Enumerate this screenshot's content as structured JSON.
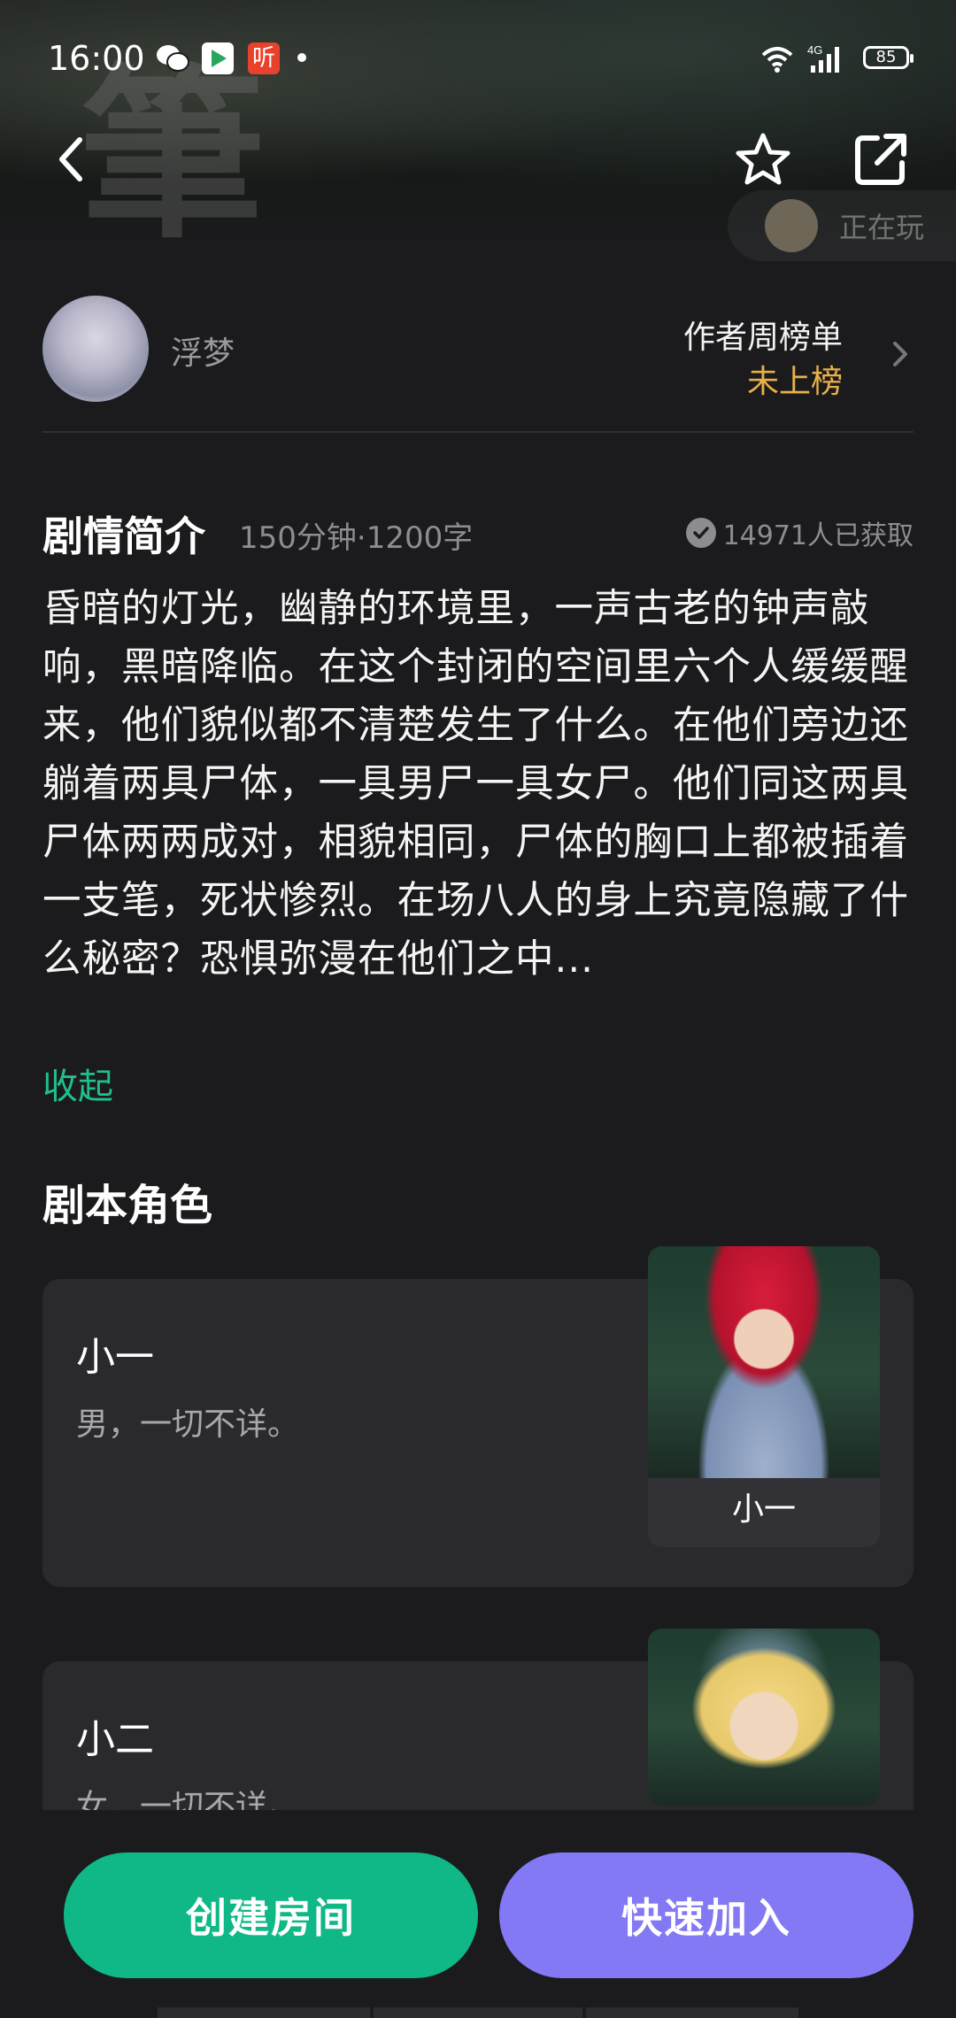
{
  "status_bar": {
    "time": "16:00",
    "battery": "85",
    "notification_icons": [
      "wechat-icon",
      "video-app-icon",
      "listen-app-icon",
      "dot-icon"
    ],
    "system_icons": [
      "wifi-icon",
      "signal-4g-icon",
      "battery-icon"
    ],
    "signal_label": "4G"
  },
  "header": {
    "back_icon": "chevron-left-icon",
    "favorite_icon": "star-icon",
    "share_icon": "external-link-icon",
    "now_playing_label": "正在玩",
    "listen_glyph": "听"
  },
  "author": {
    "name": "浮梦",
    "rank_title": "作者周榜单",
    "rank_value": "未上榜",
    "rank_value_color": "#e8b04a"
  },
  "intro": {
    "title": "剧情简介",
    "meta": "150分钟·1200字",
    "obtained": "14971人已获取",
    "description": "昏暗的灯光，幽静的环境里，一声古老的钟声敲响，黑暗降临。在这个封闭的空间里六个人缓缓醒来，他们貌似都不清楚发生了什么。在他们旁边还躺着两具尸体，一具男尸一具女尸。他们同这两具尸体两两成对，相貌相同，尸体的胸口上都被插着一支笔，死状惨烈。在场八人的身上究竟隐藏了什么秘密？恐惧弥漫在他们之中...",
    "collapse_label": "收起",
    "collapse_color": "#1fbf8f"
  },
  "roles": {
    "title": "剧本角色",
    "items": [
      {
        "name": "小一",
        "desc": "男，一切不详。",
        "pic_label": "小一"
      },
      {
        "name": "小二",
        "desc": "女，一切不详。"
      }
    ]
  },
  "actions": {
    "create_label": "创建房间",
    "create_color": "#0fb886",
    "join_label": "快速加入",
    "join_color": "#8379f4"
  }
}
